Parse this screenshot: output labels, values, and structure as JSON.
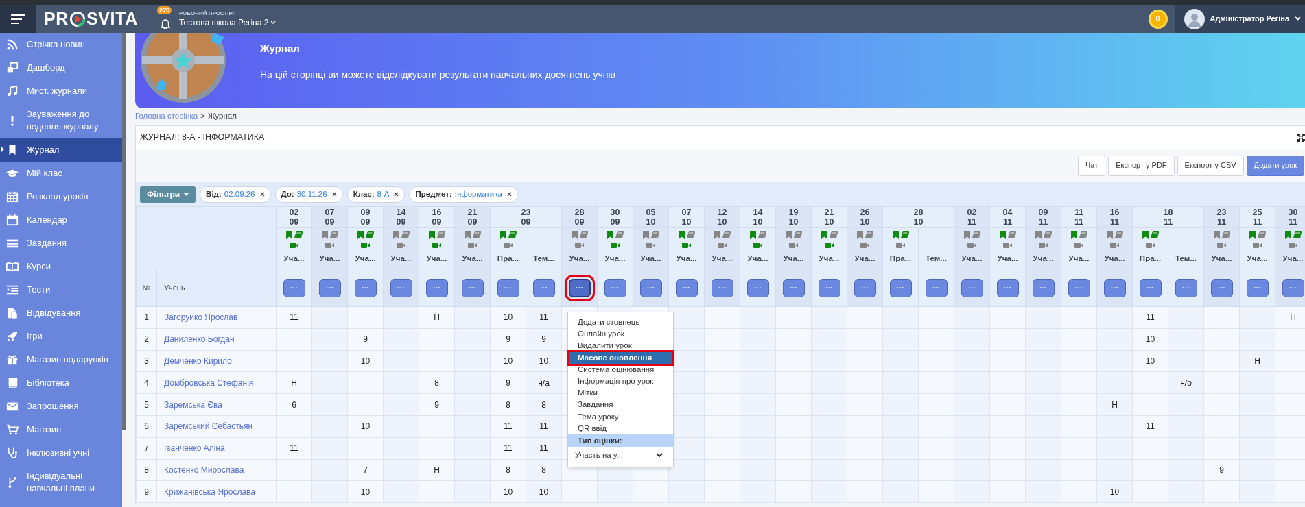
{
  "header": {
    "logo": {
      "before": "PR",
      "after": "SVITA"
    },
    "notifications": "275",
    "workspace_label": "РОБОЧИЙ ПРОСТІР:",
    "workspace": "Тестова школа Регіна 2",
    "coins": "0",
    "user": "Адміністратор Регіна"
  },
  "sidebar": {
    "items": [
      {
        "label": "Стрічка новин",
        "selected": false
      },
      {
        "label": "Дашборд",
        "selected": false
      },
      {
        "label": "Мист. журнали",
        "selected": false
      },
      {
        "label": "Зауваження до ведення журналу",
        "selected": false
      },
      {
        "label": "Журнал",
        "selected": true
      },
      {
        "label": "Мій клас",
        "selected": false
      },
      {
        "label": "Розклад уроків",
        "selected": false
      },
      {
        "label": "Календар",
        "selected": false
      },
      {
        "label": "Завдання",
        "selected": false
      },
      {
        "label": "Курси",
        "selected": false
      },
      {
        "label": "Тести",
        "selected": false
      },
      {
        "label": "Відвідування",
        "selected": false
      },
      {
        "label": "Ігри",
        "selected": false
      },
      {
        "label": "Магазин подарунків",
        "selected": false
      },
      {
        "label": "Бібліотека",
        "selected": false
      },
      {
        "label": "Запрошення",
        "selected": false
      },
      {
        "label": "Магазин",
        "selected": false
      },
      {
        "label": "Інклюзивні учні",
        "selected": false
      },
      {
        "label": "Індивідуальні навчальні плани",
        "selected": false
      }
    ]
  },
  "banner": {
    "title": "Журнал",
    "subtitle": "На цій сторінці ви можете відслідкувати результати навчальних досягнень учнів"
  },
  "breadcrumb": {
    "link": "Головна сторінка",
    "separator": ">",
    "current": "Журнал"
  },
  "journal": {
    "title": "ЖУРНАЛ: 8-А - ІНФОРМАТИКА",
    "buttons": [
      {
        "label": "Чат",
        "primary": false
      },
      {
        "label": "Експорт у PDF",
        "primary": false
      },
      {
        "label": "Експорт у CSV",
        "primary": false
      },
      {
        "label": "Додати урок",
        "primary": true
      }
    ],
    "filters": {
      "button": "Фільтри",
      "chips": [
        {
          "label": "Від:",
          "value": "02.09.26"
        },
        {
          "label": "До:",
          "value": "30.11.26"
        },
        {
          "label": "Клас:",
          "value": "8-А"
        },
        {
          "label": "Предмет:",
          "value": "Інформатика"
        }
      ]
    },
    "table": {
      "number_header": "№",
      "student_header": "Учень",
      "dates": [
        {
          "day": "02",
          "month": "09",
          "lessons": [
            {
              "kind": "lesson",
              "bookmark_on": true,
              "book_on": true,
              "video_on": true,
              "label": "Уча...",
              "button": "···",
              "selected": false
            }
          ]
        },
        {
          "day": "07",
          "month": "09",
          "lessons": [
            {
              "kind": "lesson",
              "bookmark_on": false,
              "book_on": false,
              "video_on": false,
              "label": "Уча...",
              "button": "···",
              "selected": false
            }
          ]
        },
        {
          "day": "09",
          "month": "09",
          "lessons": [
            {
              "kind": "lesson",
              "bookmark_on": true,
              "book_on": true,
              "video_on": true,
              "label": "Уча...",
              "button": "···",
              "selected": false
            }
          ]
        },
        {
          "day": "14",
          "month": "09",
          "lessons": [
            {
              "kind": "lesson",
              "bookmark_on": false,
              "book_on": false,
              "video_on": false,
              "label": "Уча...",
              "button": "···",
              "selected": false
            }
          ]
        },
        {
          "day": "16",
          "month": "09",
          "lessons": [
            {
              "kind": "lesson",
              "bookmark_on": true,
              "book_on": false,
              "video_on": true,
              "label": "Уча...",
              "button": "···",
              "selected": false
            }
          ]
        },
        {
          "day": "21",
          "month": "09",
          "lessons": [
            {
              "kind": "lesson",
              "bookmark_on": false,
              "book_on": false,
              "video_on": false,
              "label": "Уча...",
              "button": "···",
              "selected": false
            }
          ]
        },
        {
          "day": "23",
          "month": "09",
          "lessons": [
            {
              "kind": "lesson",
              "bookmark_on": true,
              "book_on": true,
              "video_on": false,
              "label": "Пра...",
              "button": "···",
              "selected": false
            },
            {
              "kind": "topic",
              "label": "Тем...",
              "button": "···",
              "selected": false
            }
          ]
        },
        {
          "day": "28",
          "month": "09",
          "lessons": [
            {
              "kind": "lesson",
              "bookmark_on": false,
              "book_on": false,
              "video_on": false,
              "label": "Уча...",
              "button": "···",
              "selected": true
            }
          ]
        },
        {
          "day": "30",
          "month": "09",
          "lessons": [
            {
              "kind": "lesson",
              "bookmark_on": true,
              "book_on": false,
              "video_on": true,
              "label": "Уча...",
              "button": "···",
              "selected": false
            }
          ]
        },
        {
          "day": "05",
          "month": "10",
          "lessons": [
            {
              "kind": "lesson",
              "bookmark_on": false,
              "book_on": false,
              "video_on": false,
              "label": "Уча...",
              "button": "···",
              "selected": false
            }
          ]
        },
        {
          "day": "07",
          "month": "10",
          "lessons": [
            {
              "kind": "lesson",
              "bookmark_on": true,
              "book_on": false,
              "video_on": true,
              "label": "Уча...",
              "button": "···",
              "selected": false
            }
          ]
        },
        {
          "day": "12",
          "month": "10",
          "lessons": [
            {
              "kind": "lesson",
              "bookmark_on": false,
              "book_on": false,
              "video_on": false,
              "label": "Уча...",
              "button": "···",
              "selected": false
            }
          ]
        },
        {
          "day": "14",
          "month": "10",
          "lessons": [
            {
              "kind": "lesson",
              "bookmark_on": true,
              "book_on": false,
              "video_on": true,
              "label": "Уча...",
              "button": "···",
              "selected": false
            }
          ]
        },
        {
          "day": "19",
          "month": "10",
          "lessons": [
            {
              "kind": "lesson",
              "bookmark_on": false,
              "book_on": false,
              "video_on": false,
              "label": "Уча...",
              "button": "···",
              "selected": false
            }
          ]
        },
        {
          "day": "21",
          "month": "10",
          "lessons": [
            {
              "kind": "lesson",
              "bookmark_on": true,
              "book_on": false,
              "video_on": true,
              "label": "Уча...",
              "button": "···",
              "selected": false
            }
          ]
        },
        {
          "day": "26",
          "month": "10",
          "lessons": [
            {
              "kind": "lesson",
              "bookmark_on": false,
              "book_on": false,
              "video_on": false,
              "label": "Уча...",
              "button": "···",
              "selected": false
            }
          ]
        },
        {
          "day": "28",
          "month": "10",
          "lessons": [
            {
              "kind": "lesson",
              "bookmark_on": true,
              "book_on": true,
              "video_on": false,
              "label": "Пра...",
              "button": "···",
              "selected": false
            },
            {
              "kind": "topic",
              "label": "Тем...",
              "button": "···",
              "selected": false
            }
          ]
        },
        {
          "day": "02",
          "month": "11",
          "lessons": [
            {
              "kind": "lesson",
              "bookmark_on": false,
              "book_on": false,
              "video_on": false,
              "label": "Уча...",
              "button": "···",
              "selected": false
            }
          ]
        },
        {
          "day": "04",
          "month": "11",
          "lessons": [
            {
              "kind": "lesson",
              "bookmark_on": true,
              "book_on": false,
              "video_on": false,
              "label": "Уча...",
              "button": "···",
              "selected": false
            }
          ]
        },
        {
          "day": "09",
          "month": "11",
          "lessons": [
            {
              "kind": "lesson",
              "bookmark_on": false,
              "book_on": false,
              "video_on": false,
              "label": "Уча...",
              "button": "···",
              "selected": false
            }
          ]
        },
        {
          "day": "11",
          "month": "11",
          "lessons": [
            {
              "kind": "lesson",
              "bookmark_on": true,
              "book_on": false,
              "video_on": false,
              "label": "Уча...",
              "button": "···",
              "selected": false
            }
          ]
        },
        {
          "day": "16",
          "month": "11",
          "lessons": [
            {
              "kind": "lesson",
              "bookmark_on": false,
              "book_on": false,
              "video_on": false,
              "label": "Уча...",
              "button": "···",
              "selected": false
            }
          ]
        },
        {
          "day": "18",
          "month": "11",
          "lessons": [
            {
              "kind": "lesson",
              "bookmark_on": true,
              "book_on": true,
              "video_on": false,
              "label": "Пра...",
              "button": "···",
              "selected": false
            },
            {
              "kind": "topic",
              "label": "Тем...",
              "button": "···",
              "selected": false
            }
          ]
        },
        {
          "day": "23",
          "month": "11",
          "lessons": [
            {
              "kind": "lesson",
              "bookmark_on": false,
              "book_on": false,
              "video_on": false,
              "label": "Уча...",
              "button": "···",
              "selected": false
            }
          ]
        },
        {
          "day": "25",
          "month": "11",
          "lessons": [
            {
              "kind": "lesson",
              "bookmark_on": true,
              "book_on": false,
              "video_on": false,
              "label": "Уча...",
              "button": "···",
              "selected": false
            }
          ]
        },
        {
          "day": "30",
          "month": "11",
          "lessons": [
            {
              "kind": "lesson",
              "bookmark_on": true,
              "book_on": true,
              "video_on": false,
              "label": "Уча...",
              "button": "···",
              "selected": false
            }
          ]
        }
      ],
      "rows": [
        {
          "number": "1",
          "name": "Загоруйко Ярослав",
          "cells": [
            {
              "grade": "11"
            },
            {},
            {},
            {},
            {
              "grade": "Н"
            },
            {},
            {
              "grade": "10"
            },
            {
              "grade": "11"
            },
            {},
            {},
            {},
            {},
            {},
            {},
            {},
            {},
            {},
            {},
            {},
            {},
            {},
            {},
            {},
            {},
            {
              "grade": "11"
            },
            {},
            {},
            {},
            {
              "grade": "Н"
            }
          ]
        },
        {
          "number": "2",
          "name": "Даниленко Богдан",
          "cells": [
            {},
            {},
            {
              "grade": "9"
            },
            {},
            {},
            {},
            {
              "grade": "9"
            },
            {
              "grade": "9"
            },
            {},
            {},
            {},
            {},
            {},
            {},
            {},
            {},
            {},
            {},
            {},
            {},
            {},
            {},
            {},
            {},
            {
              "grade": "10"
            },
            {},
            {},
            {},
            {}
          ]
        },
        {
          "number": "3",
          "name": "Демченко Кирило",
          "cells": [
            {},
            {},
            {
              "grade": "10"
            },
            {},
            {},
            {},
            {
              "grade": "10"
            },
            {
              "grade": "10"
            },
            {},
            {},
            {},
            {},
            {},
            {},
            {},
            {},
            {},
            {},
            {},
            {},
            {},
            {},
            {},
            {},
            {
              "grade": "10"
            },
            {},
            {},
            {
              "grade": "Н"
            },
            {}
          ]
        },
        {
          "number": "4",
          "name": "Домбровська Стефанія",
          "cells": [
            {
              "grade": "Н"
            },
            {},
            {},
            {},
            {
              "grade": "8"
            },
            {},
            {
              "grade": "9"
            },
            {
              "grade": "н/а"
            },
            {},
            {},
            {},
            {},
            {},
            {},
            {},
            {},
            {},
            {},
            {},
            {},
            {},
            {},
            {},
            {},
            {},
            {
              "grade": "н/о"
            },
            {},
            {},
            {}
          ]
        },
        {
          "number": "5",
          "name": "Заремська Єва",
          "cells": [
            {
              "grade": "6"
            },
            {},
            {},
            {},
            {
              "grade": "9"
            },
            {},
            {
              "grade": "8"
            },
            {
              "grade": "8"
            },
            {},
            {},
            {},
            {},
            {},
            {},
            {},
            {},
            {},
            {},
            {},
            {},
            {},
            {},
            {},
            {
              "grade": "Н"
            },
            {},
            {},
            {},
            {},
            {}
          ]
        },
        {
          "number": "6",
          "name": "Заремський Себастьян",
          "cells": [
            {},
            {},
            {
              "grade": "10"
            },
            {},
            {},
            {},
            {
              "grade": "11"
            },
            {
              "grade": "11"
            },
            {},
            {},
            {},
            {},
            {},
            {},
            {},
            {},
            {},
            {},
            {},
            {},
            {},
            {},
            {},
            {},
            {
              "grade": "11"
            },
            {},
            {},
            {},
            {}
          ]
        },
        {
          "number": "7",
          "name": "Іванченко Аліна",
          "cells": [
            {
              "grade": "11"
            },
            {},
            {},
            {},
            {},
            {},
            {
              "grade": "11"
            },
            {
              "grade": "11"
            },
            {},
            {},
            {},
            {},
            {},
            {},
            {},
            {},
            {},
            {},
            {},
            {},
            {},
            {},
            {},
            {},
            {},
            {},
            {},
            {},
            {}
          ]
        },
        {
          "number": "8",
          "name": "Костенко Мирослава",
          "cells": [
            {},
            {},
            {
              "grade": "7"
            },
            {},
            {
              "grade": "Н"
            },
            {},
            {
              "grade": "8"
            },
            {
              "grade": "8"
            },
            {},
            {},
            {},
            {},
            {},
            {},
            {},
            {},
            {},
            {},
            {},
            {},
            {},
            {},
            {},
            {},
            {},
            {},
            {
              "grade": "9"
            },
            {},
            {}
          ]
        },
        {
          "number": "9",
          "name": "Крижанівська Ярослава",
          "cells": [
            {},
            {},
            {
              "grade": "10"
            },
            {},
            {},
            {},
            {
              "grade": "10"
            },
            {
              "grade": "10"
            },
            {},
            {},
            {},
            {},
            {},
            {},
            {},
            {},
            {},
            {},
            {},
            {},
            {},
            {},
            {},
            {
              "grade": "10"
            },
            {},
            {},
            {},
            {},
            {}
          ]
        }
      ]
    },
    "menu": [
      {
        "kind": "item",
        "label": "Додати стовпець",
        "selected": false
      },
      {
        "kind": "item",
        "label": "Онлайн урок",
        "selected": false
      },
      {
        "kind": "item",
        "label": "Видалити урок",
        "selected": false
      },
      {
        "kind": "item",
        "label": "Масове оновлення",
        "selected": true
      },
      {
        "kind": "item",
        "label": "Система оцінювання",
        "selected": false
      },
      {
        "kind": "item",
        "label": "Інформація про урок",
        "selected": false
      },
      {
        "kind": "item",
        "label": "Мітки",
        "selected": false
      },
      {
        "kind": "item",
        "label": "Завдання",
        "selected": false
      },
      {
        "kind": "item",
        "label": "Тема уроку",
        "selected": false
      },
      {
        "kind": "item",
        "label": "QR ввід",
        "selected": false
      },
      {
        "kind": "header",
        "label": "Тип оцінки:"
      },
      {
        "kind": "select",
        "label": "Участь на у..."
      }
    ]
  }
}
